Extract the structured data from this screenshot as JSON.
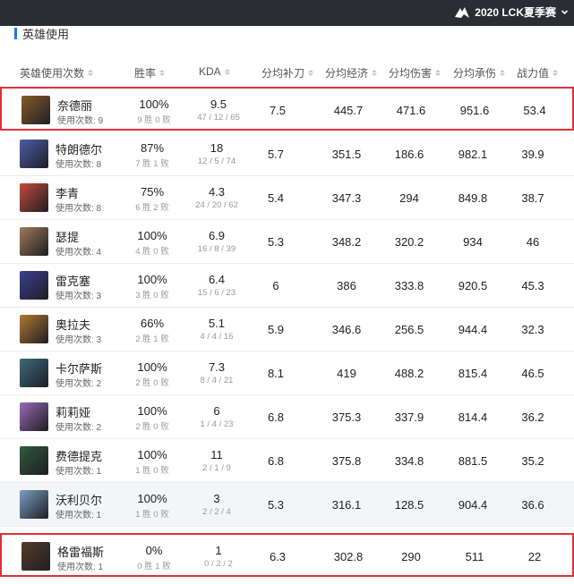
{
  "header": {
    "season": "2020 LCK夏季赛",
    "logo_icon": "team-logo-icon",
    "dropdown_icon": "chevron-down-icon"
  },
  "section": {
    "title": "英雄使用"
  },
  "columns": {
    "hero": "英雄使用次数",
    "winrate": "胜率",
    "kda": "KDA",
    "cs": "分均补刀",
    "gold": "分均经济",
    "dmg": "分均伤害",
    "taken": "分均承伤",
    "power": "战力值"
  },
  "rows": [
    {
      "name": "奈德丽",
      "uses": "使用次数: 9",
      "winrate": "100%",
      "wl": "9 胜 0 败",
      "kda": "9.5",
      "kda_detail": "47 / 12 / 65",
      "cs": "7.5",
      "gold": "445.7",
      "dmg": "471.6",
      "taken": "951.6",
      "power": "53.4",
      "color": "#8a5a2a"
    },
    {
      "name": "特朗德尔",
      "uses": "使用次数: 8",
      "winrate": "87%",
      "wl": "7 胜 1 败",
      "kda": "18",
      "kda_detail": "12 / 5 / 74",
      "cs": "5.7",
      "gold": "351.5",
      "dmg": "186.6",
      "taken": "982.1",
      "power": "39.9",
      "color": "#4b5fa8"
    },
    {
      "name": "李青",
      "uses": "使用次数: 8",
      "winrate": "75%",
      "wl": "6 胜 2 败",
      "kda": "4.3",
      "kda_detail": "24 / 20 / 62",
      "cs": "5.4",
      "gold": "347.3",
      "dmg": "294",
      "taken": "849.8",
      "power": "38.7",
      "color": "#c54a3b"
    },
    {
      "name": "瑟提",
      "uses": "使用次数: 4",
      "winrate": "100%",
      "wl": "4 胜 0 败",
      "kda": "6.9",
      "kda_detail": "16 / 8 / 39",
      "cs": "5.3",
      "gold": "348.2",
      "dmg": "320.2",
      "taken": "934",
      "power": "46",
      "color": "#a07a58"
    },
    {
      "name": "雷克塞",
      "uses": "使用次数: 3",
      "winrate": "100%",
      "wl": "3 胜 0 败",
      "kda": "6.4",
      "kda_detail": "15 / 6 / 23",
      "cs": "6",
      "gold": "386",
      "dmg": "333.8",
      "taken": "920.5",
      "power": "45.3",
      "color": "#3a3f8f"
    },
    {
      "name": "奥拉夫",
      "uses": "使用次数: 3",
      "winrate": "66%",
      "wl": "2 胜 1 败",
      "kda": "5.1",
      "kda_detail": "4 / 4 / 16",
      "cs": "5.9",
      "gold": "346.6",
      "dmg": "256.5",
      "taken": "944.4",
      "power": "32.3",
      "color": "#b07830"
    },
    {
      "name": "卡尔萨斯",
      "uses": "使用次数: 2",
      "winrate": "100%",
      "wl": "2 胜 0 败",
      "kda": "7.3",
      "kda_detail": "8 / 4 / 21",
      "cs": "8.1",
      "gold": "419",
      "dmg": "488.2",
      "taken": "815.4",
      "power": "46.5",
      "color": "#3b6b7a"
    },
    {
      "name": "莉莉娅",
      "uses": "使用次数: 2",
      "winrate": "100%",
      "wl": "2 胜 0 败",
      "kda": "6",
      "kda_detail": "1 / 4 / 23",
      "cs": "6.8",
      "gold": "375.3",
      "dmg": "337.9",
      "taken": "814.4",
      "power": "36.2",
      "color": "#9a6ab8"
    },
    {
      "name": "费德提克",
      "uses": "使用次数: 1",
      "winrate": "100%",
      "wl": "1 胜 0 败",
      "kda": "11",
      "kda_detail": "2 / 1 / 9",
      "cs": "6.8",
      "gold": "375.8",
      "dmg": "334.8",
      "taken": "881.5",
      "power": "35.2",
      "color": "#2f5a3a"
    },
    {
      "name": "沃利贝尔",
      "uses": "使用次数: 1",
      "winrate": "100%",
      "wl": "1 胜 0 败",
      "kda": "3",
      "kda_detail": "2 / 2 / 4",
      "cs": "5.3",
      "gold": "316.1",
      "dmg": "128.5",
      "taken": "904.4",
      "power": "36.6",
      "color": "#7aa0c0"
    },
    {
      "name": "格雷福斯",
      "uses": "使用次数: 1",
      "winrate": "0%",
      "wl": "0 胜 1 败",
      "kda": "1",
      "kda_detail": "0 / 2 / 2",
      "cs": "6.3",
      "gold": "302.8",
      "dmg": "290",
      "taken": "511",
      "power": "22",
      "color": "#5a3b2a"
    }
  ]
}
